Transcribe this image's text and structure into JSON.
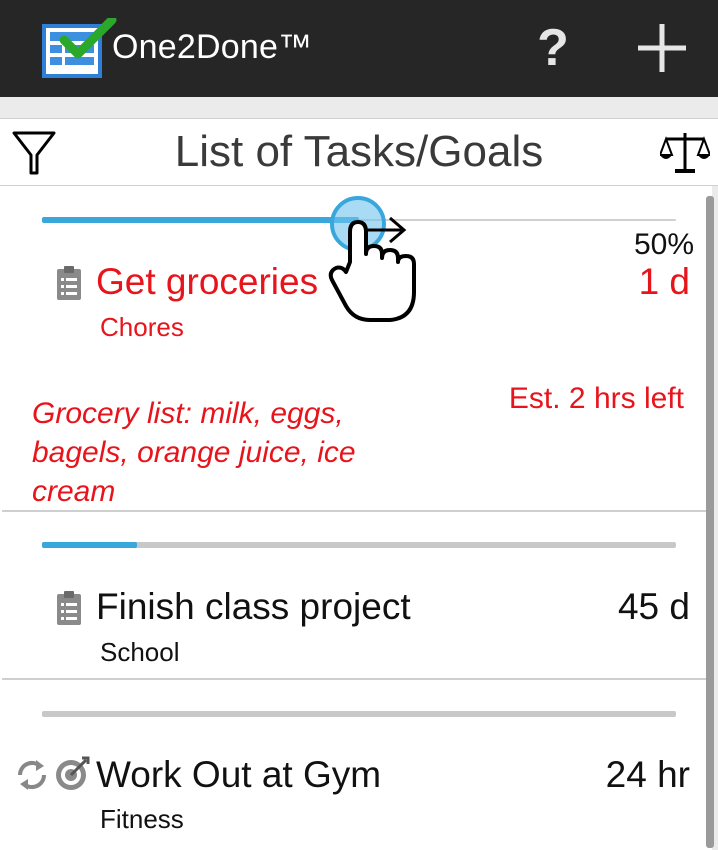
{
  "app": {
    "title": "One2Done™",
    "help_label": "?",
    "icons": {
      "logo": "checklist-logo-icon",
      "help": "help-icon",
      "add": "add-icon"
    }
  },
  "header": {
    "title": "List of Tasks/Goals",
    "icons": {
      "filter": "filter-icon",
      "sort": "balance-scale-icon"
    }
  },
  "tasks": [
    {
      "name": "Get groceries",
      "category": "Chores",
      "due": "1 d",
      "progress_percent": 50,
      "progress_label": "50%",
      "note": "Grocery list: milk, eggs, bagels, orange juice, ice cream",
      "estimate": "Est. 2 hrs left",
      "color": "#e8141b",
      "icon": "clipboard-icon"
    },
    {
      "name": "Finish class project",
      "category": "School",
      "due": "45 d",
      "progress_percent": 15,
      "color": "#111111",
      "icon": "clipboard-icon"
    },
    {
      "name": "Work Out at Gym",
      "category": "Fitness",
      "due": "24 hr",
      "progress_percent": 0,
      "color": "#111111",
      "icons": [
        "repeat-icon",
        "target-icon"
      ]
    }
  ],
  "colors": {
    "accent": "#3aa7dc",
    "overdue": "#e8141b",
    "actionbar": "#262626"
  }
}
